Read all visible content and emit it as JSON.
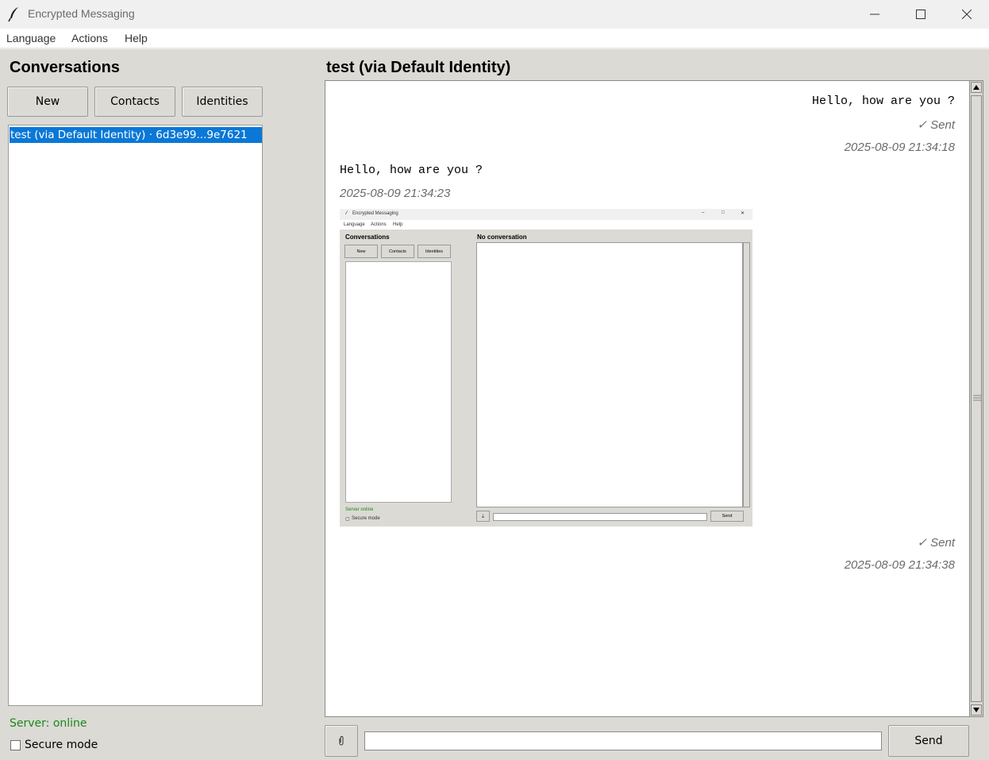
{
  "window": {
    "title": "Encrypted Messaging"
  },
  "menu": {
    "items": [
      "Language",
      "Actions",
      "Help"
    ]
  },
  "sidebar": {
    "title": "Conversations",
    "buttons": {
      "new": "New",
      "contacts": "Contacts",
      "identities": "Identities"
    },
    "conversations": [
      {
        "label": "test (via Default Identity) · 6d3e99...9e7621",
        "selected": true
      }
    ],
    "server_status": "Server: online",
    "secure_mode_label": "Secure mode",
    "secure_mode_checked": false
  },
  "chat": {
    "title": "test  (via Default Identity)",
    "messages": [
      {
        "direction": "outgoing",
        "text": "Hello, how are you ?",
        "status": "✓ Sent",
        "timestamp": "2025-08-09 21:34:18"
      },
      {
        "direction": "incoming",
        "text": "Hello, how are you ?",
        "timestamp": "2025-08-09 21:34:23"
      },
      {
        "direction": "outgoing",
        "attachment": "image",
        "status": "✓ Sent",
        "timestamp": "2025-08-09 21:34:38"
      }
    ],
    "input_value": "",
    "attach_icon": "paperclip-icon",
    "send_label": "Send"
  },
  "attachment_image": {
    "window_title": "Encrypted Messaging",
    "menu": [
      "Language",
      "Actions",
      "Help"
    ],
    "sidebar_title": "Conversations",
    "buttons": [
      "New",
      "Contacts",
      "Identities"
    ],
    "chat_title": "No conversation",
    "server_status": "Server online",
    "secure_mode_label": "Secure mode",
    "send_label": "Send"
  },
  "colors": {
    "selection": "#0a78d7",
    "server_online": "#1a8a1a",
    "panel_bg": "#dcdad5"
  }
}
